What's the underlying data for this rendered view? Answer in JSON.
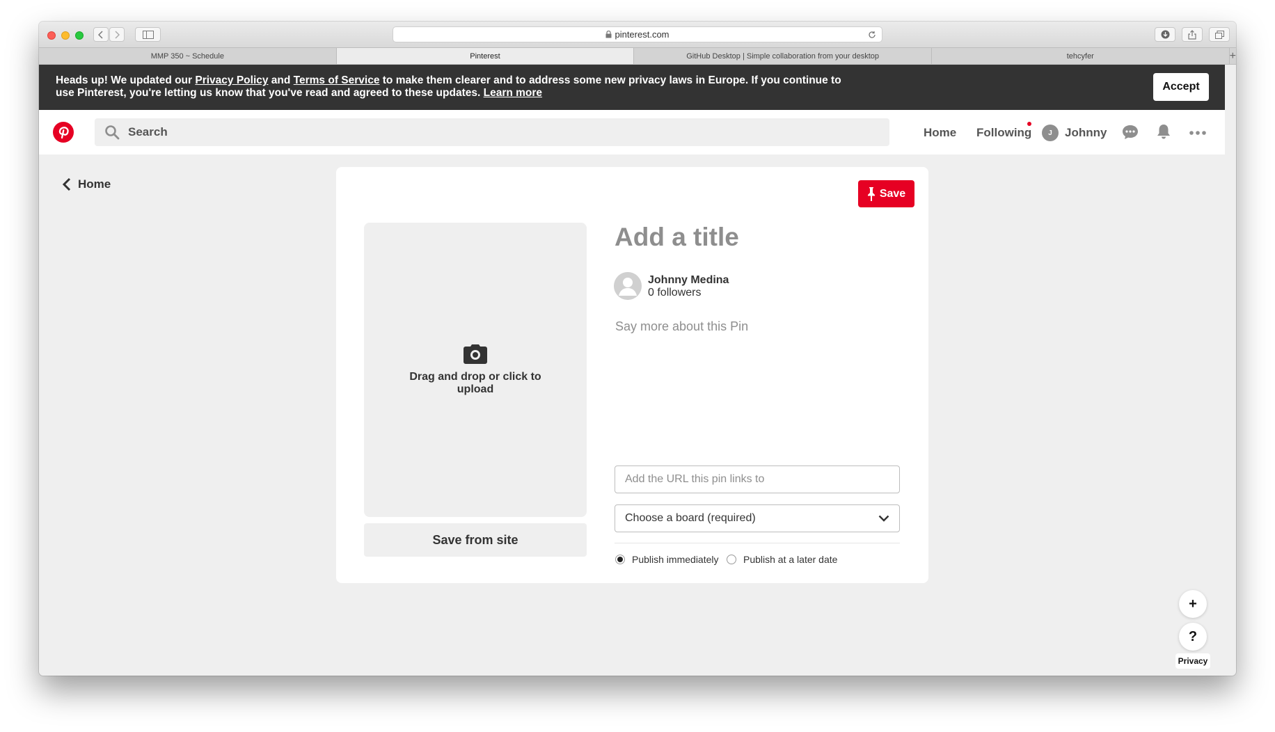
{
  "browser": {
    "address": "pinterest.com",
    "tabs": [
      {
        "label": "MMP 350 ~ Schedule"
      },
      {
        "label": "Pinterest"
      },
      {
        "label": "GitHub Desktop | Simple collaboration from your desktop"
      },
      {
        "label": "tehcyfer"
      }
    ],
    "new_tab_symbol": "+"
  },
  "banner": {
    "text_1": "Heads up! We updated our ",
    "privacy_link": "Privacy Policy",
    "text_2": " and ",
    "terms_link": "Terms of Service",
    "text_3": " to make them clearer and to address some new privacy laws in Europe. If you continue to use Pinterest, you're letting us know that you've read and agreed to these updates. ",
    "learn_more_link": "Learn more",
    "accept_label": "Accept"
  },
  "header": {
    "search_placeholder": "Search",
    "nav": {
      "home": "Home",
      "following": "Following",
      "user": "Johnny",
      "user_initial": "J"
    },
    "brand_color": "#e60023"
  },
  "back_link": {
    "label": "Home"
  },
  "pin_form": {
    "save_label": "Save",
    "upload_text": "Drag and drop or click to upload",
    "save_from_site_label": "Save from site",
    "title_placeholder": "Add a title",
    "author_name": "Johnny Medina",
    "author_followers": "0 followers",
    "description_placeholder": "Say more about this Pin",
    "url_placeholder": "Add the URL this pin links to",
    "board_select": "Choose a board (required)",
    "publish_immediately": "Publish immediately",
    "publish_later": "Publish at a later date",
    "publish_option_selected": "immediately"
  },
  "floating": {
    "add_symbol": "+",
    "help_symbol": "?",
    "privacy_label": "Privacy"
  }
}
